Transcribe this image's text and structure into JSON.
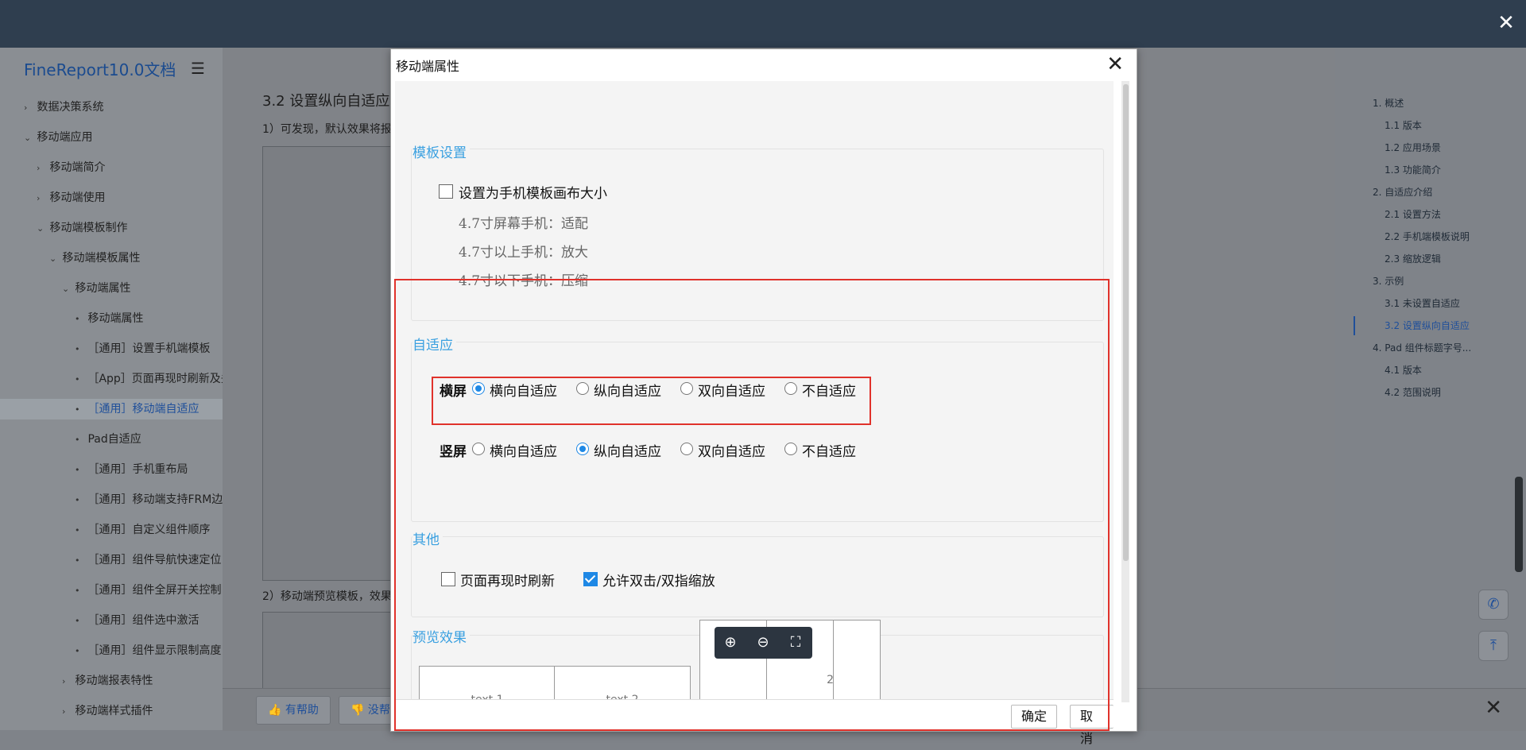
{
  "doc": {
    "brand": "FineReport10.0文档",
    "nav": [
      {
        "label": "数据决策系统",
        "arrow": "›"
      },
      {
        "label": "移动端应用",
        "arrow": "⌄"
      },
      {
        "label": "移动端简介",
        "arrow": "›"
      },
      {
        "label": "移动端使用",
        "arrow": "›"
      },
      {
        "label": "移动端模板制作",
        "arrow": "⌄"
      },
      {
        "label": "移动端模板属性",
        "arrow": "⌄"
      },
      {
        "label": "移动端属性",
        "arrow": "⌄"
      },
      {
        "label": "移动端属性",
        "arrow": "•"
      },
      {
        "label": "［通用］设置手机端模板",
        "arrow": "•"
      },
      {
        "label": "［App］页面再现时刷新及头",
        "arrow": "•"
      },
      {
        "label": "［通用］移动端自适应",
        "arrow": "•"
      },
      {
        "label": "Pad自适应",
        "arrow": "•"
      },
      {
        "label": "［通用］手机重布局",
        "arrow": "•"
      },
      {
        "label": "［通用］移动端支持FRM边距",
        "arrow": "•"
      },
      {
        "label": "［通用］自定义组件顺序",
        "arrow": "•"
      },
      {
        "label": "［通用］组件导航快速定位",
        "arrow": "•"
      },
      {
        "label": "［通用］组件全屏开关控制",
        "arrow": "•"
      },
      {
        "label": "［通用］组件选中激活",
        "arrow": "•"
      },
      {
        "label": "［通用］组件显示限制高度",
        "arrow": "•"
      },
      {
        "label": "移动端报表特性",
        "arrow": "›"
      },
      {
        "label": "移动端样式插件",
        "arrow": "›"
      }
    ],
    "heading": "3.2 设置纵向自适应",
    "paragraph1": "1）可发现，默认效果将报",
    "paragraph2": "2）移动端预览模板，效果",
    "toc": [
      "1. 概述",
      "1.1 版本",
      "1.2 应用场景",
      "1.3 功能简介",
      "2. 自适应介绍",
      "2.1 设置方法",
      "2.2 手机端模板说明",
      "2.3 缩放逻辑",
      "3. 示例",
      "3.1 未设置自适应",
      "3.2 设置纵向自适应",
      "4. Pad 组件标题字号...",
      "4.1 版本",
      "4.2 范围说明"
    ],
    "helpful": "有帮助",
    "not_helpful": "没帮"
  },
  "dialog": {
    "title": "移动端属性",
    "template_section": "模板设置",
    "phone_canvas_label": "设置为手机模板画布大小",
    "rule1": "4.7寸屏幕手机：适配",
    "rule2": "4.7寸以上手机：放大",
    "rule3": "4.7寸以下手机：压缩",
    "adaptive_section": "自适应",
    "landscape_label": "横屏",
    "portrait_label": "竖屏",
    "opt_horizontal": "横向自适应",
    "opt_vertical": "纵向自适应",
    "opt_both": "双向自适应",
    "opt_none": "不自适应",
    "landscape_selected": "横向自适应",
    "portrait_selected": "纵向自适应",
    "other_section": "其他",
    "refresh_label": "页面再现时刷新",
    "refresh_checked": false,
    "zoom_label": "允许双击/双指缩放",
    "zoom_checked": true,
    "preview_section": "预览效果",
    "preview_cell1": "text 1",
    "preview_cell2": "text 2",
    "preview_cell_partial": "2",
    "ok": "确定",
    "cancel": "取消"
  }
}
